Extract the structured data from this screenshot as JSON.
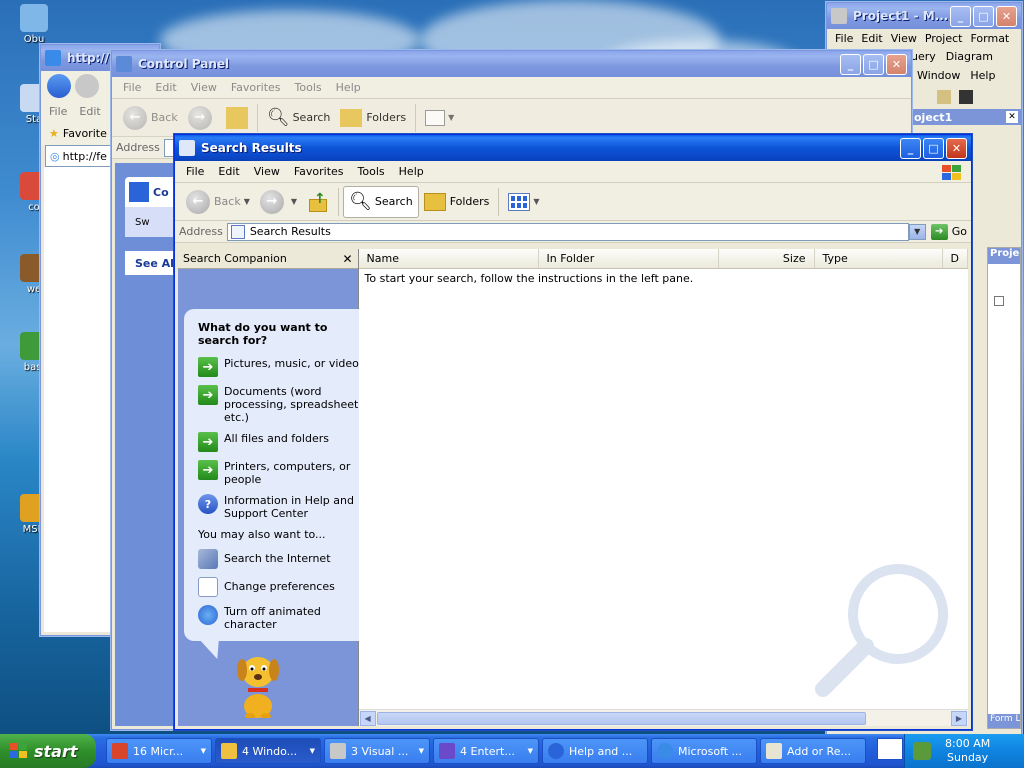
{
  "desktop": {
    "icons": [
      {
        "label": "Obu",
        "icon": "recycle-bin-icon",
        "color": "#7fb8e8"
      },
      {
        "label": "Sta",
        "icon": "start-shortcut-icon",
        "color": "#c8d9f2"
      },
      {
        "label": "co",
        "icon": "program-shortcut-icon",
        "color": "#d94a3a"
      },
      {
        "label": "we",
        "icon": "program-shortcut-icon",
        "color": "#8b5a2b"
      },
      {
        "label": "basi",
        "icon": "program-shortcut-icon",
        "color": "#3f9a3a"
      },
      {
        "label": "MSD",
        "icon": "program-shortcut-icon",
        "color": "#e0a020"
      }
    ]
  },
  "ie_window": {
    "address_prefix": "http://",
    "menu": [
      "File",
      "Edit"
    ],
    "favorites_label": "Favorite",
    "address_value": "http://fe"
  },
  "vb_window": {
    "title": "Project1 - M...",
    "menu_row1": [
      "File",
      "Edit",
      "View",
      "Project",
      "Format"
    ],
    "menu_row2": [
      "uery",
      "Diagram"
    ],
    "menu_row3": [
      "Window",
      "Help"
    ],
    "panel_title": "oject1",
    "project_label": "Project",
    "form_label": "Form L"
  },
  "control_panel": {
    "title": "Control Panel",
    "menu": [
      "File",
      "Edit",
      "View",
      "Favorites",
      "Tools",
      "Help"
    ],
    "back_label": "Back",
    "search_label": "Search",
    "folders_label": "Folders",
    "address_label": "Address",
    "side_title": "Co",
    "side_item": "Sw",
    "see_also": "See Al"
  },
  "search_window": {
    "title": "Search Results",
    "menu": [
      "File",
      "Edit",
      "View",
      "Favorites",
      "Tools",
      "Help"
    ],
    "toolbar": {
      "back": "Back",
      "search": "Search",
      "folders": "Folders"
    },
    "address_label": "Address",
    "address_value": "Search Results",
    "go_label": "Go",
    "companion": {
      "header": "Search Companion",
      "question": "What do you want to search for?",
      "options": [
        "Pictures, music, or video",
        "Documents (word processing, spreadsheet, etc.)",
        "All files and folders",
        "Printers, computers, or people",
        "Information in Help and Support Center"
      ],
      "also_label": "You may also want to...",
      "also_options": [
        "Search the Internet",
        "Change preferences",
        "Turn off animated character"
      ]
    },
    "columns": [
      "Name",
      "In Folder",
      "Size",
      "Type",
      "D"
    ],
    "hint": "To start your search, follow the instructions in the left pane."
  },
  "taskbar": {
    "start_label": "start",
    "tasks": [
      {
        "label": "16 Micr...",
        "icon": "office-icon",
        "color": "#d9452b"
      },
      {
        "label": "4 Windo...",
        "icon": "folder-icon",
        "color": "#f0c040"
      },
      {
        "label": "3 Visual ...",
        "icon": "visual-studio-icon",
        "color": "#c8c8c8"
      },
      {
        "label": "4 Entert...",
        "icon": "entertainment-icon",
        "color": "#6a4ac8"
      },
      {
        "label": "Help and ...",
        "icon": "help-icon",
        "color": "#2a64d8"
      },
      {
        "label": "Microsoft ...",
        "icon": "ie-icon",
        "color": "#3a8ae8"
      },
      {
        "label": "Add or Re...",
        "icon": "add-remove-icon",
        "color": "#e8e4d4"
      }
    ],
    "time": "8:00 AM",
    "day": "Sunday"
  },
  "colors": {
    "xp_blue": "#0a46c4",
    "start_green": "#2f8f2a",
    "companion_bg": "#7b95d8"
  }
}
